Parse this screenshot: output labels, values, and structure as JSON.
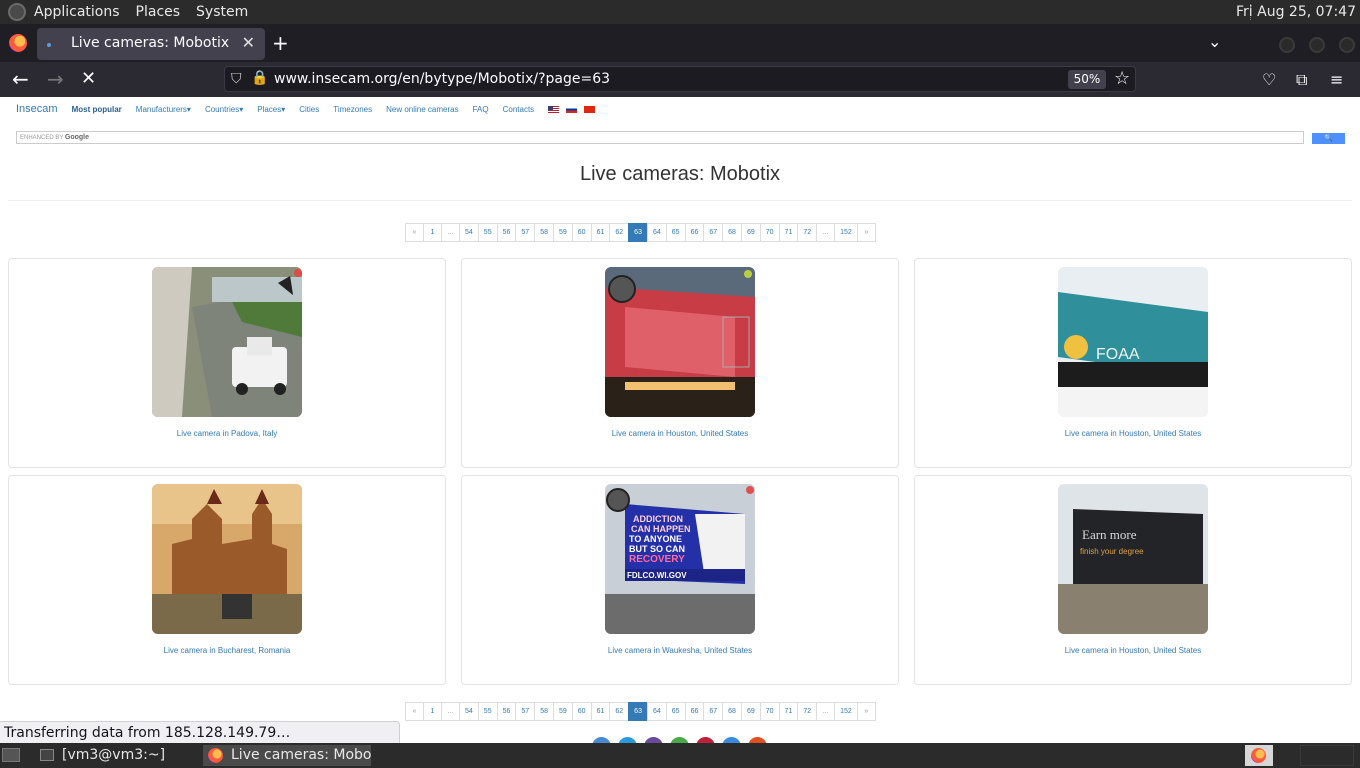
{
  "top_panel": {
    "menus": [
      "Applications",
      "Places",
      "System"
    ],
    "clock": "Fri Aug 25, 07:47"
  },
  "browser": {
    "tab_title": "Live cameras: Mobotix",
    "url": "www.insecam.org/en/bytype/Mobotix/?page=63",
    "zoom": "50%",
    "status_text": "Transferring data from 185.128.149.79…"
  },
  "site": {
    "brand": "Insecam",
    "nav": [
      "Most popular",
      "Manufacturers▾",
      "Countries▾",
      "Places▾",
      "Cities",
      "Timezones",
      "New online cameras",
      "FAQ",
      "Contacts"
    ],
    "search_enhanced": "ENHANCED BY",
    "search_google": "Google",
    "search_button": "🔍",
    "page_title": "Live cameras: Mobotix",
    "pager": [
      "«",
      "1",
      "...",
      "54",
      "55",
      "56",
      "57",
      "58",
      "59",
      "60",
      "61",
      "62",
      "63",
      "64",
      "65",
      "66",
      "67",
      "68",
      "69",
      "70",
      "71",
      "72",
      "...",
      "152",
      "»"
    ],
    "current_page": "63",
    "cameras": [
      {
        "caption": "Live camera in Padova, Italy"
      },
      {
        "caption": "Live camera in Houston, United States"
      },
      {
        "caption": "Live camera in Houston, United States"
      },
      {
        "caption": "Live camera in Bucharest, Romania"
      },
      {
        "caption": "Live camera in Waukesha, United States"
      },
      {
        "caption": "Live camera in Houston, United States"
      }
    ],
    "billboard_texts": {
      "waukesha": [
        "ADDICTION",
        "CAN HAPPEN",
        "TO ANYONE",
        "BUT SO CAN",
        "RECOVERY",
        "FDLCO.WI.GOV"
      ],
      "houston1": [
        "FOAA"
      ],
      "houston3": [
        "Earn more",
        "finish your degree"
      ]
    }
  },
  "taskbar": {
    "terminal": "[vm3@vm3:~]",
    "firefox": "Live cameras: Mobot…"
  }
}
